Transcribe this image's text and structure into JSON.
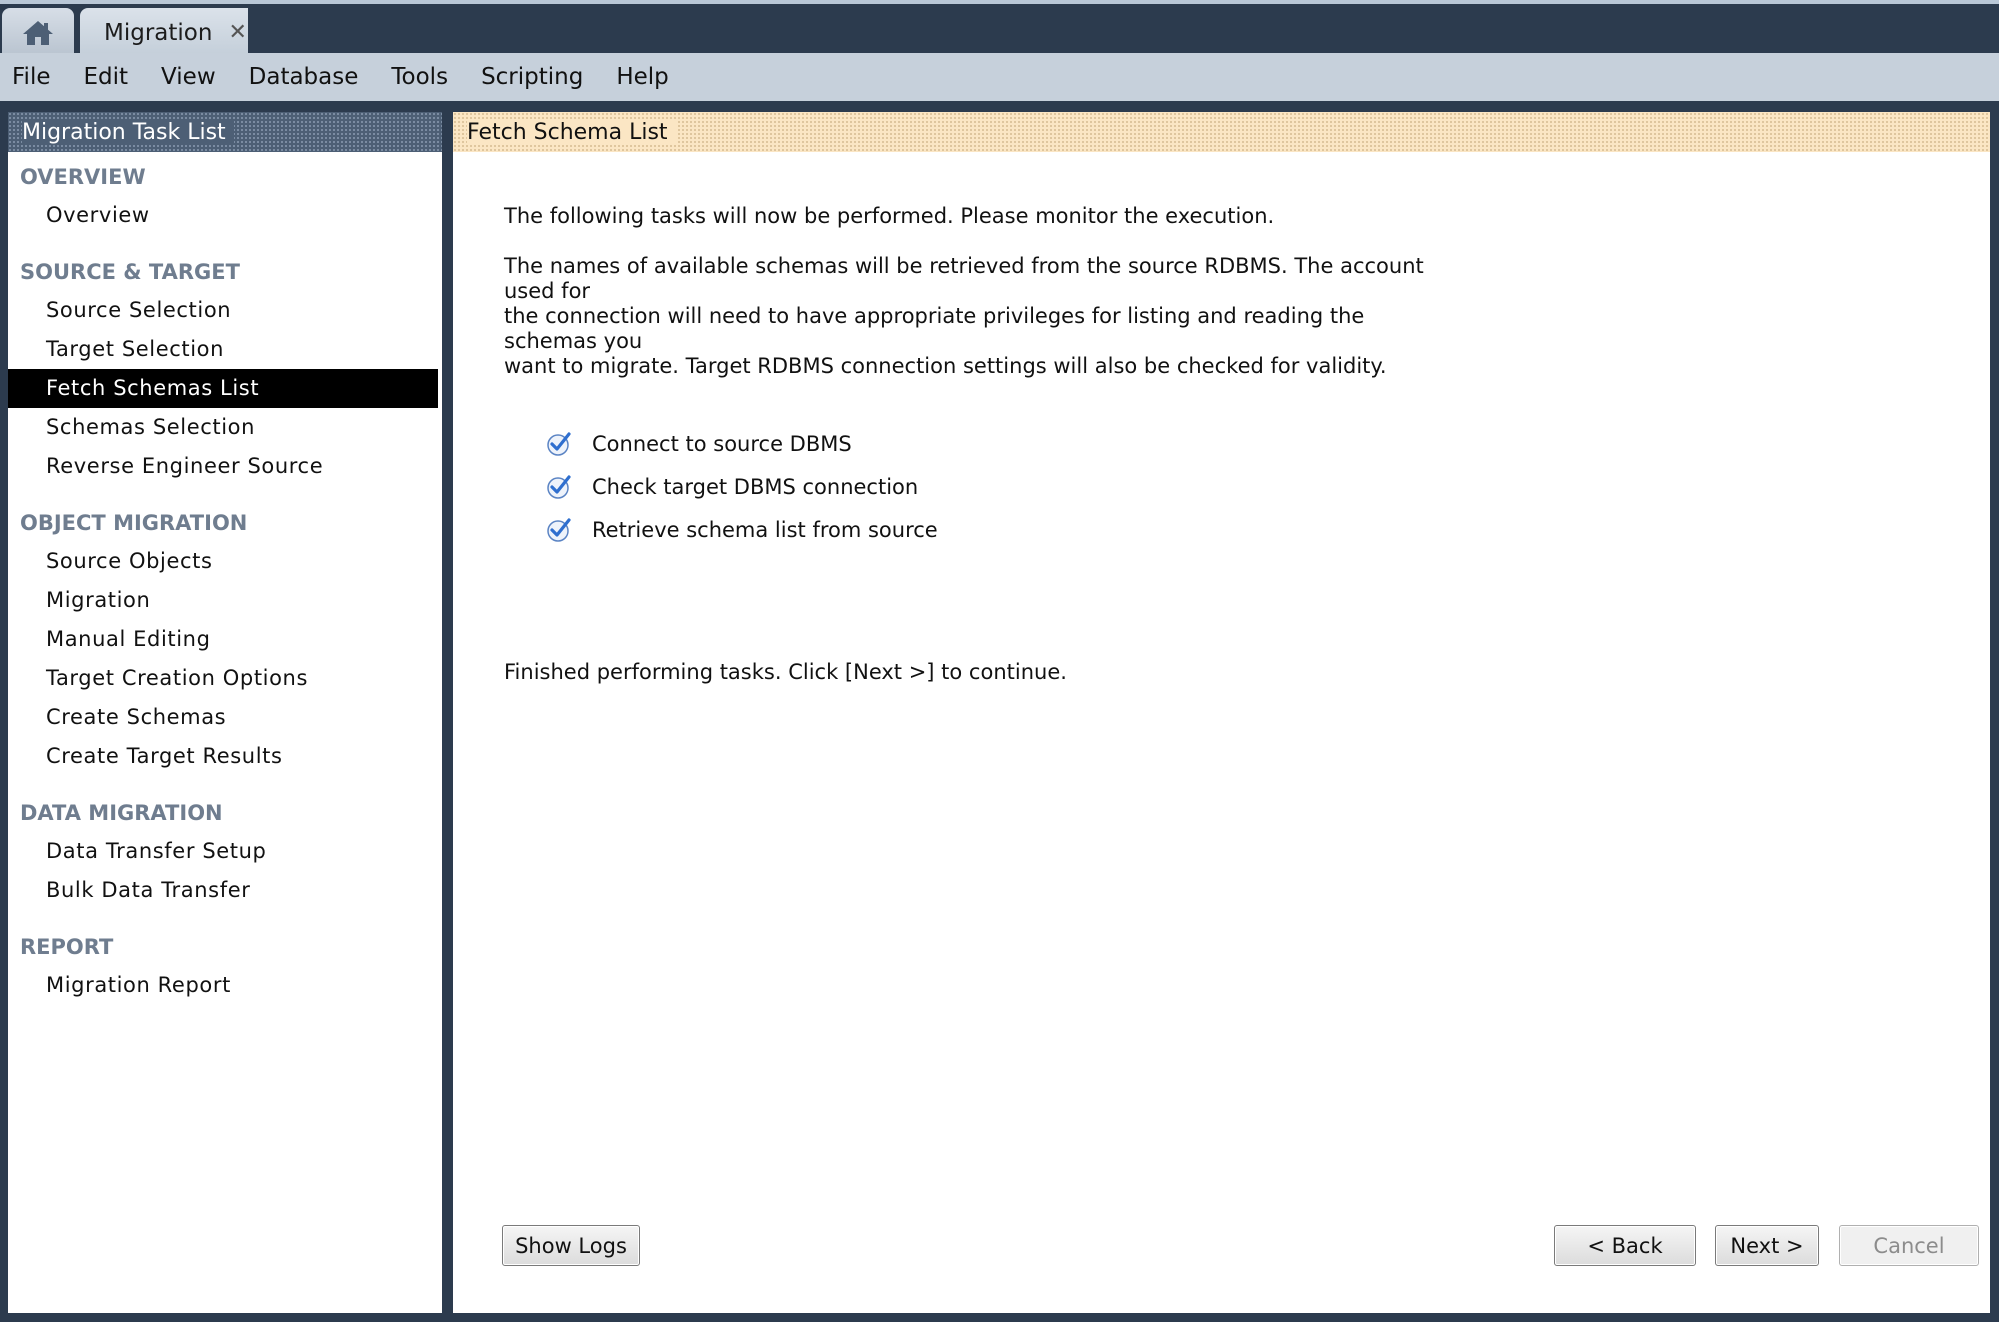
{
  "tabs": {
    "home_icon": "home-icon",
    "active_tab_label": "Migration",
    "close_glyph": "✕"
  },
  "menu": [
    "File",
    "Edit",
    "View",
    "Database",
    "Tools",
    "Scripting",
    "Help"
  ],
  "sidebar": {
    "title": "Migration Task List",
    "sections": [
      {
        "title": "OVERVIEW",
        "items": [
          "Overview"
        ]
      },
      {
        "title": "SOURCE & TARGET",
        "items": [
          "Source Selection",
          "Target Selection",
          "Fetch Schemas List",
          "Schemas Selection",
          "Reverse Engineer Source"
        ]
      },
      {
        "title": "OBJECT MIGRATION",
        "items": [
          "Source Objects",
          "Migration",
          "Manual Editing",
          "Target Creation Options",
          "Create Schemas",
          "Create Target Results"
        ]
      },
      {
        "title": "DATA MIGRATION",
        "items": [
          "Data Transfer Setup",
          "Bulk Data Transfer"
        ]
      },
      {
        "title": "REPORT",
        "items": [
          "Migration Report"
        ]
      }
    ],
    "selected_item": "Fetch Schemas List"
  },
  "main": {
    "title": "Fetch Schema List",
    "intro": "The following tasks will now be performed. Please monitor the execution.",
    "description_lines": [
      "The names of available schemas will be retrieved from the source RDBMS. The account used for",
      "the connection will need to have appropriate privileges for listing and reading the schemas you",
      "want to migrate. Target RDBMS connection settings will also be checked for validity."
    ],
    "tasks": [
      {
        "label": "Connect to source DBMS",
        "status": "done"
      },
      {
        "label": "Check target DBMS connection",
        "status": "done"
      },
      {
        "label": "Retrieve schema list from source",
        "status": "done"
      }
    ],
    "finish_text": "Finished performing tasks. Click [Next >] to continue."
  },
  "buttons": {
    "show_logs": "Show Logs",
    "back": "< Back",
    "next": "Next >",
    "cancel": "Cancel"
  },
  "colors": {
    "check_blue": "#2f6fcf",
    "selected_bg": "#000000",
    "section_title": "#6f7d8f"
  }
}
